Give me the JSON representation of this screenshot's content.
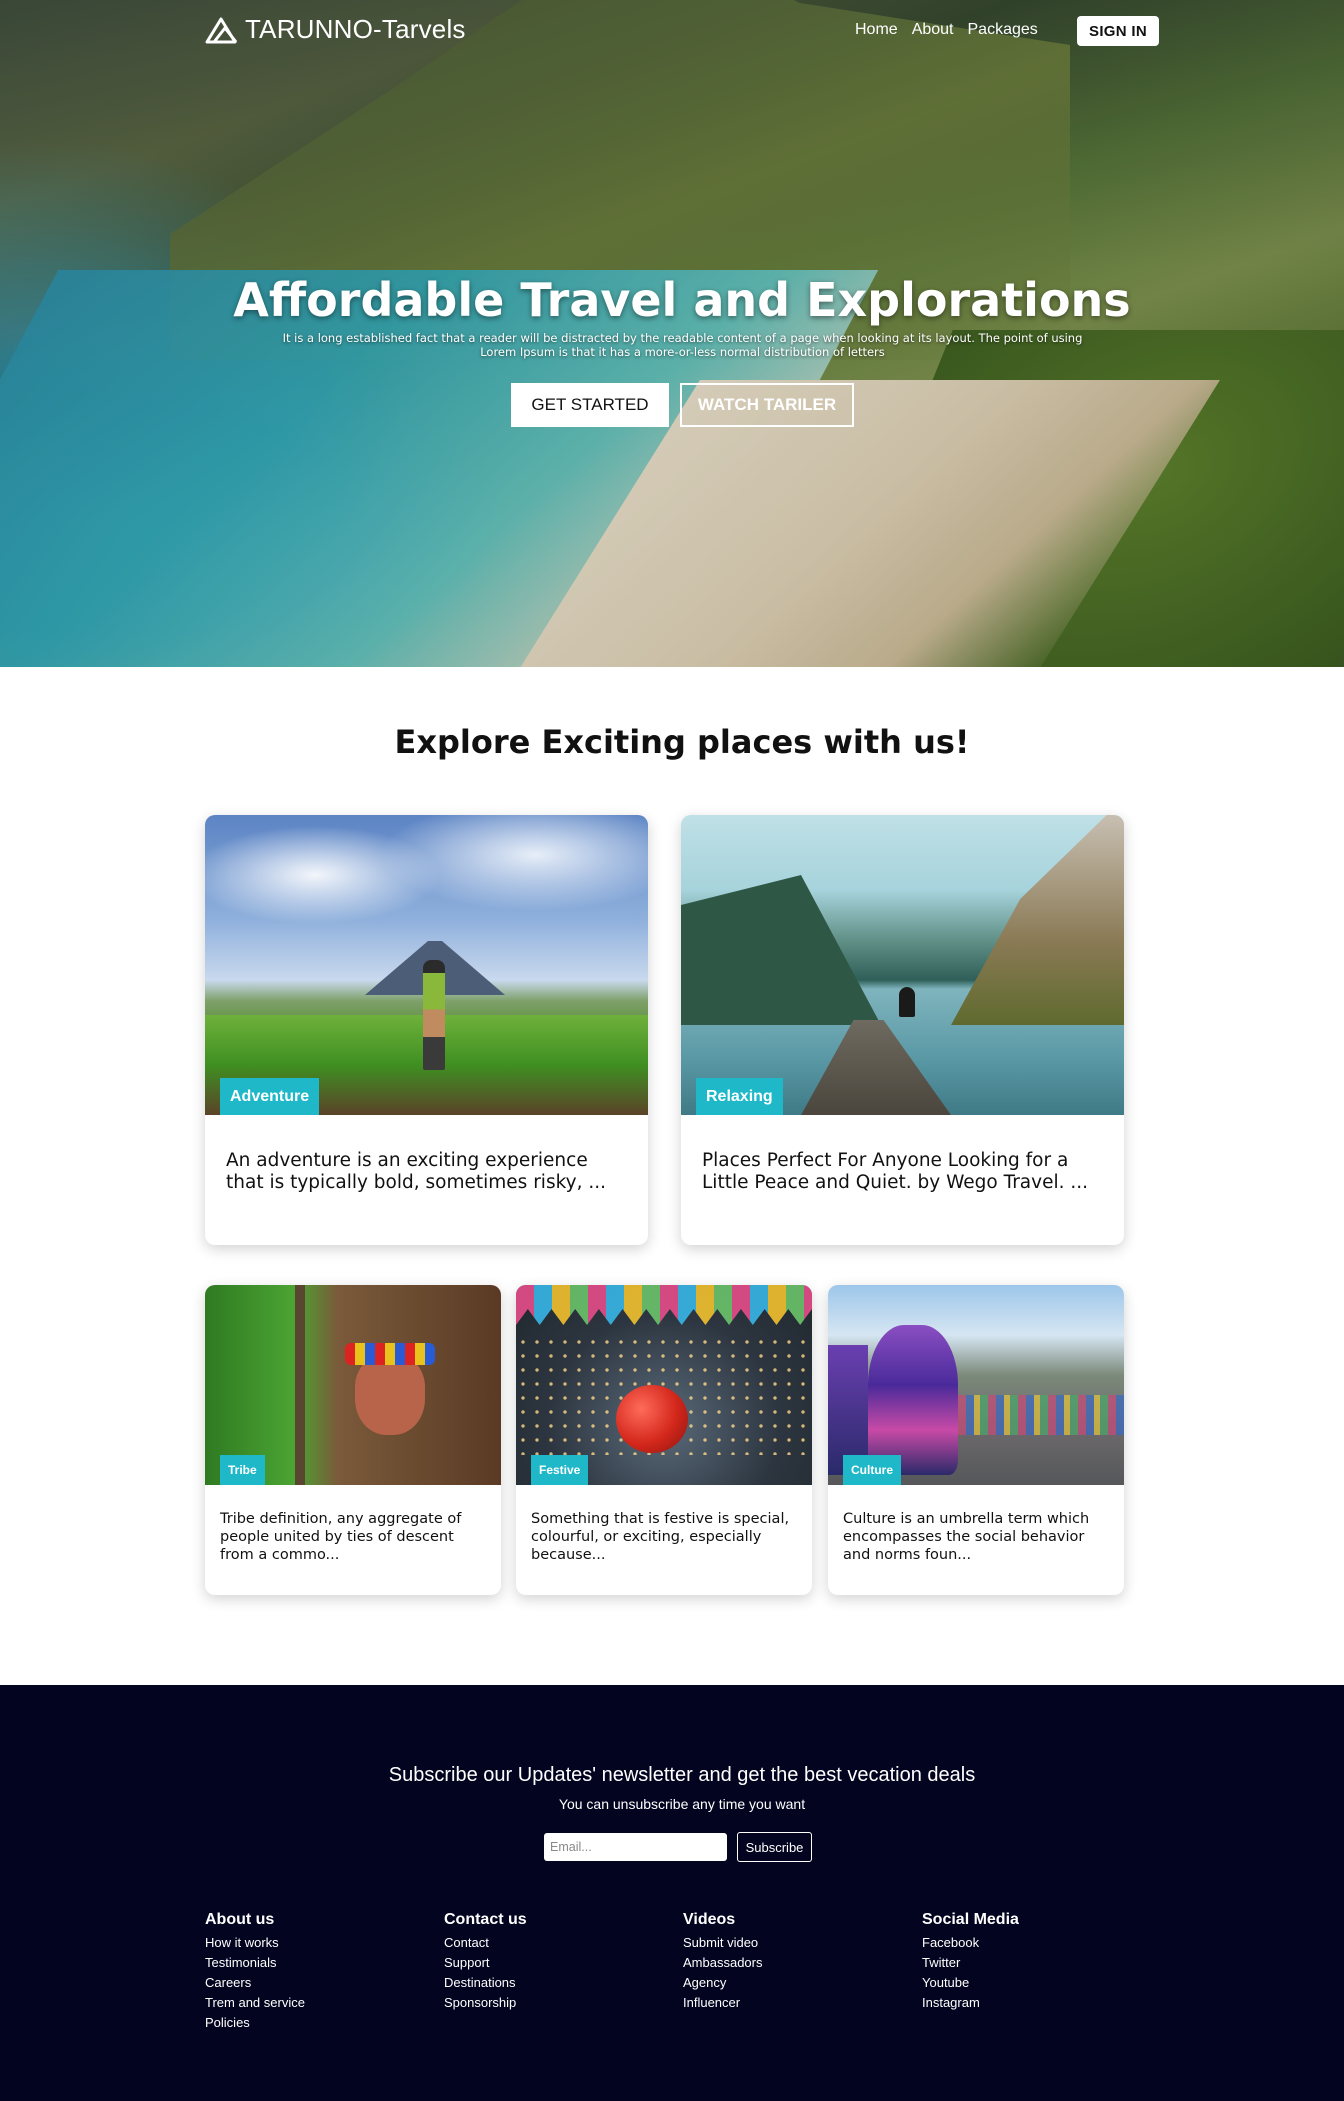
{
  "brand": {
    "name": "TARUNNO-Tarvels"
  },
  "nav": {
    "links": [
      "Home",
      "About",
      "Packages"
    ],
    "signin_label": "SIGN IN"
  },
  "hero": {
    "title": "Affordable Travel and Explorations",
    "subtitle": "It is a long established fact that a reader will be distracted by the readable content of a page when looking at its layout. The point of using Lorem Ipsum is that it has a more-or-less normal distribution of letters",
    "primary_button": "GET STARTED",
    "secondary_button": "WATCH TARILER"
  },
  "explore": {
    "title": "Explore Exciting places with us!",
    "featured": [
      {
        "tag": "Adventure",
        "text": "An adventure is an exciting experience that is typically bold, sometimes risky, ..."
      },
      {
        "tag": "Relaxing",
        "text": "Places Perfect For Anyone Looking for a Little Peace and Quiet. by Wego Travel. ..."
      }
    ],
    "cards": [
      {
        "tag": "Tribe",
        "text": "Tribe definition, any aggregate of people united by ties of descent from a commo..."
      },
      {
        "tag": "Festive",
        "text": "Something that is festive is special, colourful, or exciting, especially because..."
      },
      {
        "tag": "Culture",
        "text": "Culture is an umbrella term which encompasses the social behavior and norms foun..."
      }
    ]
  },
  "newsletter": {
    "title": "Subscribe our Updates' newsletter and get the best vecation deals",
    "subtitle": "You can unsubscribe any time you want",
    "email_placeholder": "Email...",
    "button": "Subscribe"
  },
  "footer": {
    "columns": [
      {
        "heading": "About us",
        "links": [
          "How it works",
          "Testimonials",
          "Careers",
          "Trem and service",
          "Policies"
        ]
      },
      {
        "heading": "Contact us",
        "links": [
          "Contact",
          "Support",
          "Destinations",
          "Sponsorship"
        ]
      },
      {
        "heading": "Videos",
        "links": [
          "Submit video",
          "Ambassadors",
          "Agency",
          "Influencer"
        ]
      },
      {
        "heading": "Social Media",
        "links": [
          "Facebook",
          "Twitter",
          "Youtube",
          "Instagram"
        ]
      }
    ]
  },
  "colors": {
    "tag_accent": "#1fb8c8",
    "footer_bg": "#03041f"
  }
}
